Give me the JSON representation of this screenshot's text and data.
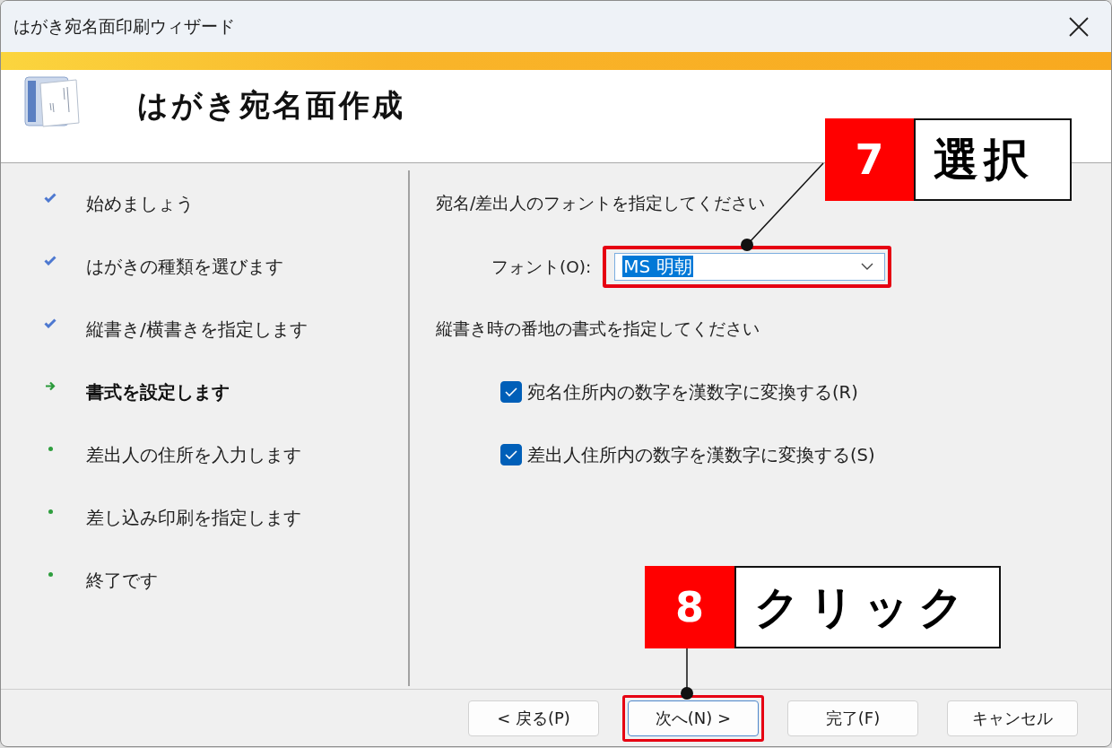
{
  "window": {
    "title": "はがき宛名面印刷ウィザード"
  },
  "header": {
    "title": "はがき宛名面作成"
  },
  "steps": [
    {
      "label": "始めましょう",
      "kind": "done"
    },
    {
      "label": "はがきの種類を選びます",
      "kind": "done"
    },
    {
      "label": "縦書き/横書きを指定します",
      "kind": "done"
    },
    {
      "label": "書式を設定します",
      "kind": "current"
    },
    {
      "label": "差出人の住所を入力します",
      "kind": "pending"
    },
    {
      "label": "差し込み印刷を指定します",
      "kind": "pending"
    },
    {
      "label": "終了です",
      "kind": "pending"
    }
  ],
  "font_section": {
    "heading": "宛名/差出人のフォントを指定してください",
    "font_label": "フォント(O):",
    "font_value": "MS 明朝",
    "value_highlighted": true,
    "marked": true
  },
  "address_section": {
    "heading": "縦書き時の番地の書式を指定してください",
    "checkboxes": [
      {
        "label": "宛名住所内の数字を漢数字に変換する(R)",
        "checked": true
      },
      {
        "label": "差出人住所内の数字を漢数字に変換する(S)",
        "checked": true
      }
    ]
  },
  "buttons": [
    {
      "label": "< 戻る(P)",
      "default": false,
      "marked": false
    },
    {
      "label": "次へ(N) >",
      "default": true,
      "marked": true
    },
    {
      "label": "完了(F)",
      "default": false,
      "marked": false
    },
    {
      "label": "キャンセル",
      "default": false,
      "marked": false
    }
  ],
  "callouts": [
    {
      "number": "7",
      "label": "選択"
    },
    {
      "number": "8",
      "label": "クリック"
    }
  ]
}
